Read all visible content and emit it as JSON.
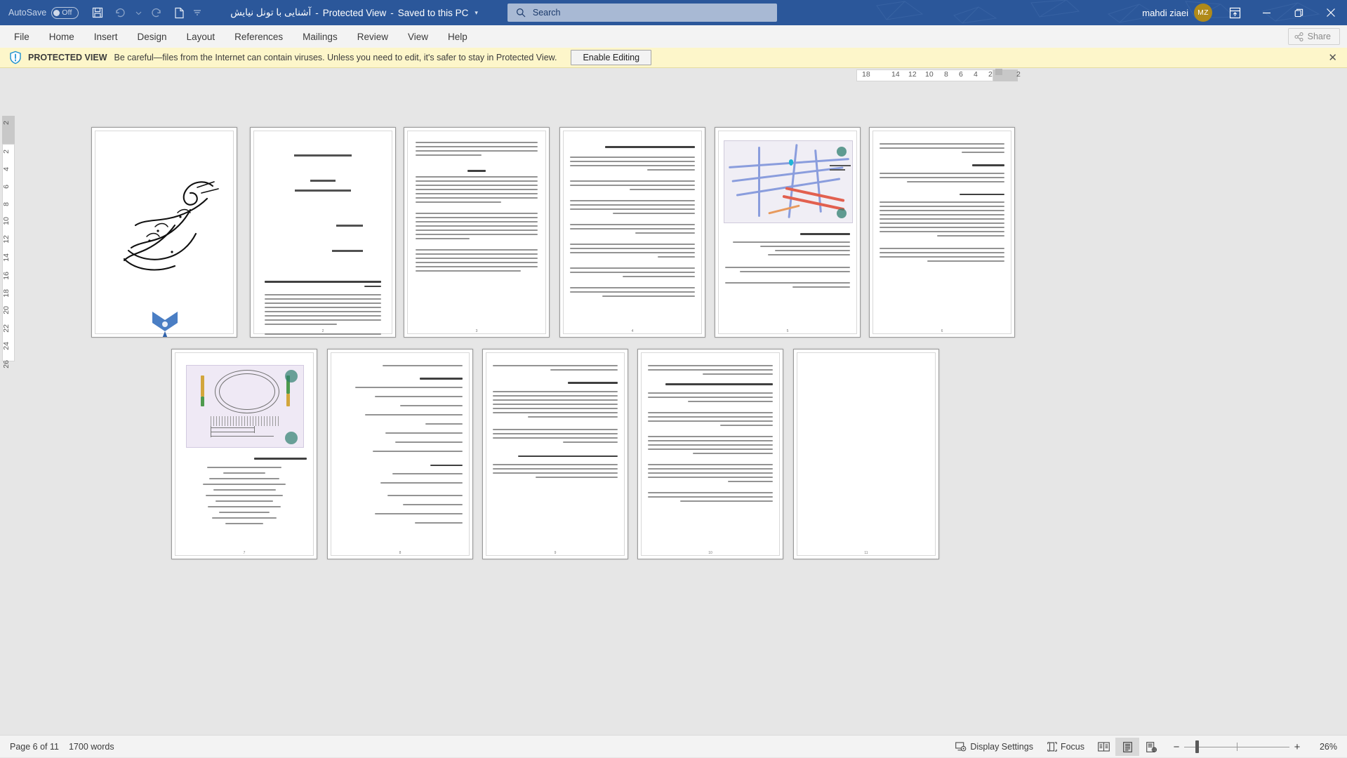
{
  "titlebar": {
    "autosave_label": "AutoSave",
    "autosave_state": "Off",
    "qat": [
      {
        "name": "save-icon",
        "glyph": "💾"
      },
      {
        "name": "undo-icon",
        "glyph": "↶"
      },
      {
        "name": "undo-dropdown-icon",
        "glyph": "˅"
      },
      {
        "name": "redo-icon",
        "glyph": "↷"
      },
      {
        "name": "new-file-icon",
        "glyph": "🗎"
      },
      {
        "name": "customize-qat-icon",
        "glyph": "˅"
      }
    ],
    "document_title": "آشنایی با تونل نیایش",
    "protected_view_label": "Protected View",
    "saved_label": "Saved to this PC",
    "title_caret": "▾",
    "search_placeholder": "Search",
    "search_icon": "⌕",
    "user_name": "mahdi ziaei",
    "user_initials": "MZ",
    "ribbon_display_icon": "ribbon-display-options-icon",
    "minimize": "–",
    "restore": "❐",
    "close": "✕"
  },
  "ribbon": {
    "tabs": [
      {
        "label": "File"
      },
      {
        "label": "Home"
      },
      {
        "label": "Insert"
      },
      {
        "label": "Design"
      },
      {
        "label": "Layout"
      },
      {
        "label": "References"
      },
      {
        "label": "Mailings"
      },
      {
        "label": "Review"
      },
      {
        "label": "View"
      },
      {
        "label": "Help"
      }
    ],
    "share_label": "Share",
    "share_icon": "share-icon"
  },
  "protected_view": {
    "icon": "shield-info-icon",
    "strong": "PROTECTED VIEW",
    "message": "Be careful—files from the Internet can contain viruses. Unless you need to edit, it's safer to stay in Protected View.",
    "button_label": "Enable Editing",
    "close_icon": "✕"
  },
  "rulers": {
    "corner_tab_label": "L",
    "horizontal_numbers": [
      "18",
      "14",
      "12",
      "10",
      "8",
      "6",
      "4",
      "2",
      "2"
    ],
    "vertical_numbers": [
      "2",
      "2",
      "4",
      "6",
      "8",
      "10",
      "12",
      "14",
      "16",
      "18",
      "20",
      "22",
      "24",
      "26"
    ]
  },
  "document": {
    "page_count_visible": 11,
    "pages": [
      {
        "number": "1",
        "kind": "calligraphy",
        "label": "bismillah-calligraphy-page"
      },
      {
        "number": "2",
        "kind": "title",
        "label": "title-page",
        "heading": "دانشگاه آزاد اسلامی واحد",
        "subject_label": "موضوع",
        "subject": "آشنایی با تونل نیایش تهران",
        "prof_label": "استاد :",
        "student_label": "دانشجو :"
      },
      {
        "number": "3",
        "kind": "text",
        "label": "text-page-3"
      },
      {
        "number": "4",
        "kind": "text",
        "label": "text-page-4",
        "heading": "تونل نیایش با طول تقی بیش از ۱۰ کیلومتر در شهر تهران قرار دارد"
      },
      {
        "number": "5",
        "kind": "map",
        "label": "map-page-5",
        "caption": "مقطع عرض شامل:"
      },
      {
        "number": "6",
        "kind": "text",
        "label": "text-page-6",
        "heading": "روش اجرا"
      },
      {
        "number": "7",
        "kind": "diagram",
        "label": "diagram-page-7",
        "heading": "شرح اقدام‌های اصلی پروژه:"
      },
      {
        "number": "8",
        "kind": "text",
        "label": "text-page-8",
        "heading": "مزایا و اهداف طرح:"
      },
      {
        "number": "9",
        "kind": "text",
        "label": "text-page-9",
        "heading": "تونل نیایش چهارمین تونل‌‌راه برتر جهان در سال ۲۰۱۴"
      },
      {
        "number": "10",
        "kind": "text",
        "label": "text-page-10",
        "heading": "Striving for excellence"
      },
      {
        "number": "11",
        "kind": "blank",
        "label": "blank-page-11"
      }
    ]
  },
  "statusbar": {
    "page_status": "Page 6 of 11",
    "word_count": "1700 words",
    "display_settings_label": "Display Settings",
    "display_settings_icon": "display-settings-icon",
    "focus_label": "Focus",
    "focus_icon": "focus-mode-icon",
    "view_buttons": [
      {
        "name": "read-mode-icon",
        "active": false
      },
      {
        "name": "print-layout-icon",
        "active": true
      },
      {
        "name": "web-layout-icon",
        "active": false
      }
    ],
    "zoom_out": "−",
    "zoom_in": "+",
    "zoom_level": "26%"
  },
  "colors": {
    "brand": "#2b579a",
    "accent_avatar": "#b08a19",
    "protected_bg": "#fdf6ca",
    "canvas_bg": "#e6e6e6"
  }
}
